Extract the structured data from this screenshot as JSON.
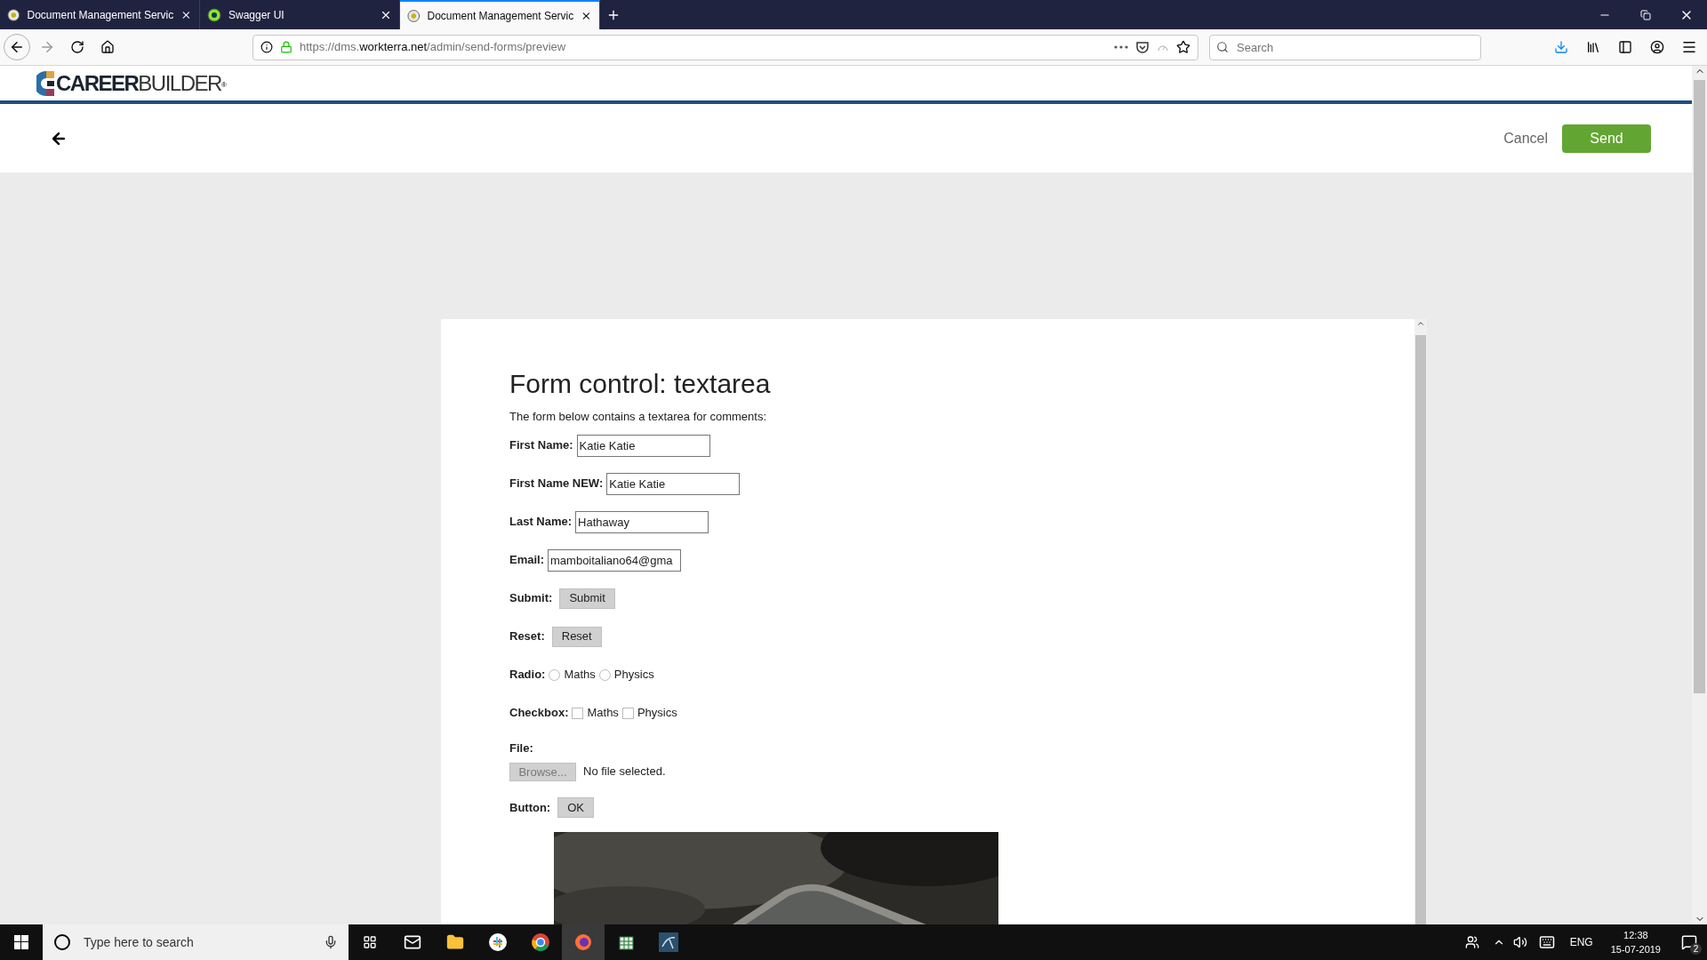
{
  "browser": {
    "tabs": [
      {
        "title": "Document Management Servic",
        "selected": false
      },
      {
        "title": "Swagger UI",
        "selected": false
      },
      {
        "title": "Document Management Servic",
        "selected": true
      }
    ],
    "url": {
      "prefix": "https://dms.",
      "domain": "workterra.net",
      "path": "/admin/send-forms/preview"
    },
    "search": {
      "placeholder": "Search"
    }
  },
  "header": {
    "logo": {
      "bold": "CAREER",
      "light": "BUILDER",
      "mark": "®"
    }
  },
  "toolbar": {
    "cancel": "Cancel",
    "send": "Send"
  },
  "form": {
    "heading": "Form control: textarea",
    "intro": "The form below contains a textarea for comments:",
    "rows": [
      {
        "kind": "text",
        "label": "First Name:",
        "value": "Katie Katie"
      },
      {
        "kind": "text",
        "label": "First Name NEW:",
        "value": "Katie Katie"
      },
      {
        "kind": "text",
        "label": "Last Name:",
        "value": "Hathaway"
      },
      {
        "kind": "text",
        "label": "Email:",
        "value": "mamboitaliano64@gma"
      },
      {
        "kind": "button",
        "label": "Submit:",
        "button": "Submit"
      },
      {
        "kind": "button",
        "label": "Reset:",
        "button": "Reset"
      },
      {
        "kind": "radio",
        "label": "Radio:",
        "options": [
          {
            "label": "Maths",
            "selected": false
          },
          {
            "label": "Physics",
            "selected": false
          }
        ]
      },
      {
        "kind": "checkbox",
        "label": "Checkbox:",
        "options": [
          {
            "label": "Maths",
            "checked": false
          },
          {
            "label": "Physics",
            "checked": false
          }
        ]
      },
      {
        "kind": "file",
        "label": "File:",
        "button": "Browse...",
        "status": "No file selected."
      },
      {
        "kind": "button",
        "label": "Button:",
        "button": "OK"
      }
    ]
  },
  "taskbar": {
    "search_placeholder": "Type here to search",
    "language": "ENG",
    "time": "12:38",
    "date": "15-07-2019",
    "notifications": "2"
  }
}
